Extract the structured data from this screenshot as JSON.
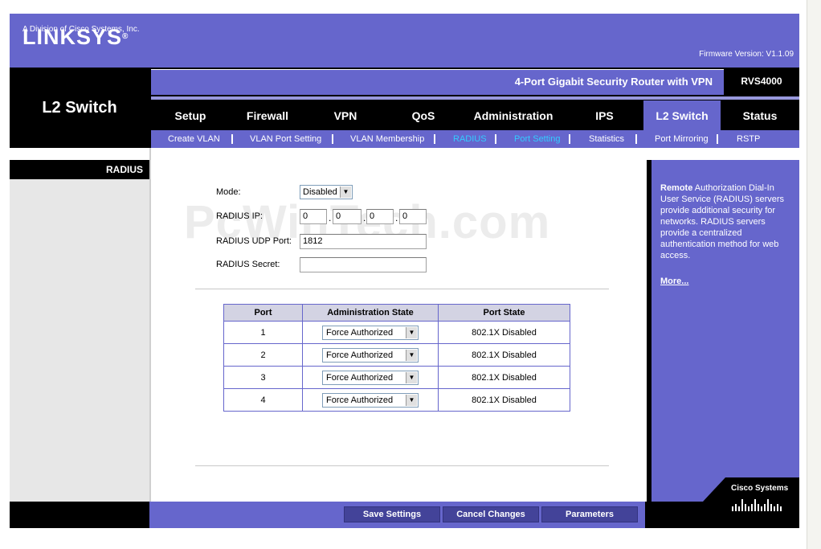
{
  "header": {
    "brand": "LINKSYS",
    "brand_reg": "®",
    "brand_sub": "A Division of Cisco Systems, Inc.",
    "firmware": "Firmware Version: V1.1.09",
    "section_title": "L2 Switch",
    "product_name": "4-Port Gigabit Security Router with VPN",
    "model": "RVS4000"
  },
  "tabs": [
    {
      "label": "Setup"
    },
    {
      "label": "Firewall"
    },
    {
      "label": "VPN"
    },
    {
      "label": "QoS"
    },
    {
      "label": "Administration"
    },
    {
      "label": "IPS"
    },
    {
      "label": "L2 Switch",
      "active": true
    },
    {
      "label": "Status"
    }
  ],
  "subtabs": [
    {
      "label": "Create VLAN"
    },
    {
      "label": "VLAN Port Setting"
    },
    {
      "label": "VLAN Membership"
    },
    {
      "label": "RADIUS",
      "active": true
    },
    {
      "label": "Port Setting"
    },
    {
      "label": "Statistics"
    },
    {
      "label": "Port Mirroring"
    },
    {
      "label": "RSTP"
    }
  ],
  "left": {
    "label": "RADIUS"
  },
  "form": {
    "mode_label": "Mode:",
    "mode_value": "Disabled",
    "ip_label": "RADIUS IP:",
    "ip": [
      "0",
      "0",
      "0",
      "0"
    ],
    "port_label": "RADIUS UDP Port:",
    "port_value": "1812",
    "secret_label": "RADIUS Secret:",
    "secret_value": ""
  },
  "watermark": "PcWinTech.com",
  "table": {
    "headers": [
      "Port",
      "Administration State",
      "Port State"
    ],
    "rows": [
      {
        "port": "1",
        "admin": "Force Authorized",
        "state": "802.1X Disabled"
      },
      {
        "port": "2",
        "admin": "Force Authorized",
        "state": "802.1X Disabled"
      },
      {
        "port": "3",
        "admin": "Force Authorized",
        "state": "802.1X Disabled"
      },
      {
        "port": "4",
        "admin": "Force Authorized",
        "state": "802.1X Disabled"
      }
    ]
  },
  "help": {
    "bold": "Remote",
    "text": " Authorization Dial-In User Service (RADIUS) servers provide additional security for networks. RADIUS servers provide a centralized authentication method for web access.",
    "more": "More..."
  },
  "cisco": {
    "name": "Cisco Systems"
  },
  "footer": {
    "save": "Save Settings",
    "cancel": "Cancel Changes",
    "parameters": "Parameters"
  },
  "colors": {
    "accent": "#6666cc",
    "active_subtab": "#33ccff"
  }
}
